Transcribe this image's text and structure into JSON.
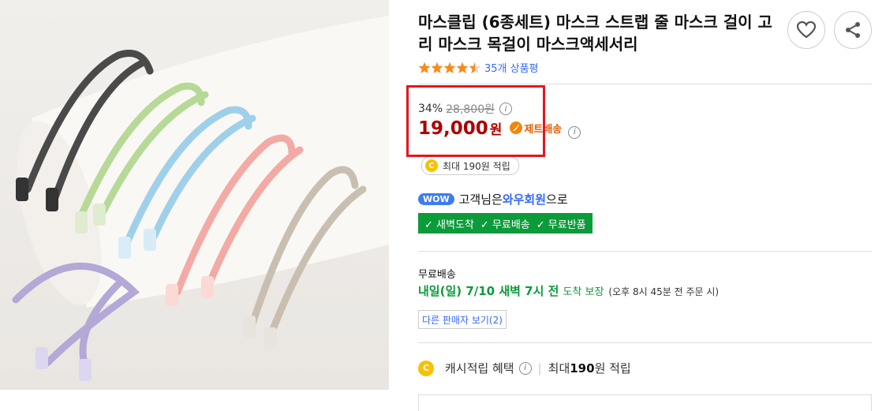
{
  "product": {
    "title": "마스클립 (6종세트) 마스크 스트랩 줄 마스크 걸이 고리 마스크 목걸이 마스크액세서리",
    "rating_stars": 4.5,
    "review_count": "35개 상품평"
  },
  "actions": {
    "wishlist_icon": "heart-icon",
    "share_icon": "share-icon"
  },
  "price": {
    "discount_rate": "34%",
    "original_price": "28,800원",
    "sale_price": "19,000",
    "currency": "원",
    "jet_delivery": "제트배송",
    "max_points": "최대 190원 적립"
  },
  "wow": {
    "badge": "WOW",
    "prefix": "고객님은 ",
    "member": "와우회원",
    "suffix": "으로",
    "benefits": [
      "✓ 새벽도착",
      "✓ 무료배송",
      "✓ 무료반품"
    ]
  },
  "shipping": {
    "label": "무료배송",
    "date": "내일(일) 7/10 새벽 7시 전",
    "guarantee": "도착 보장",
    "condition": "(오후 8시 45분 전 주문 시)",
    "other_sellers": "다른 판매자 보기(2)"
  },
  "cash": {
    "coin": "C",
    "label": "캐시적립 혜택",
    "separator": "|",
    "max_prefix": "최대 ",
    "amount": "190",
    "max_suffix": "원 적립"
  },
  "colors": {
    "price_red": "#ae0000",
    "highlight_red": "#e8141d",
    "link_blue": "#346aff",
    "wow_green": "#0c9b3a",
    "star_orange": "#f68b1e"
  }
}
